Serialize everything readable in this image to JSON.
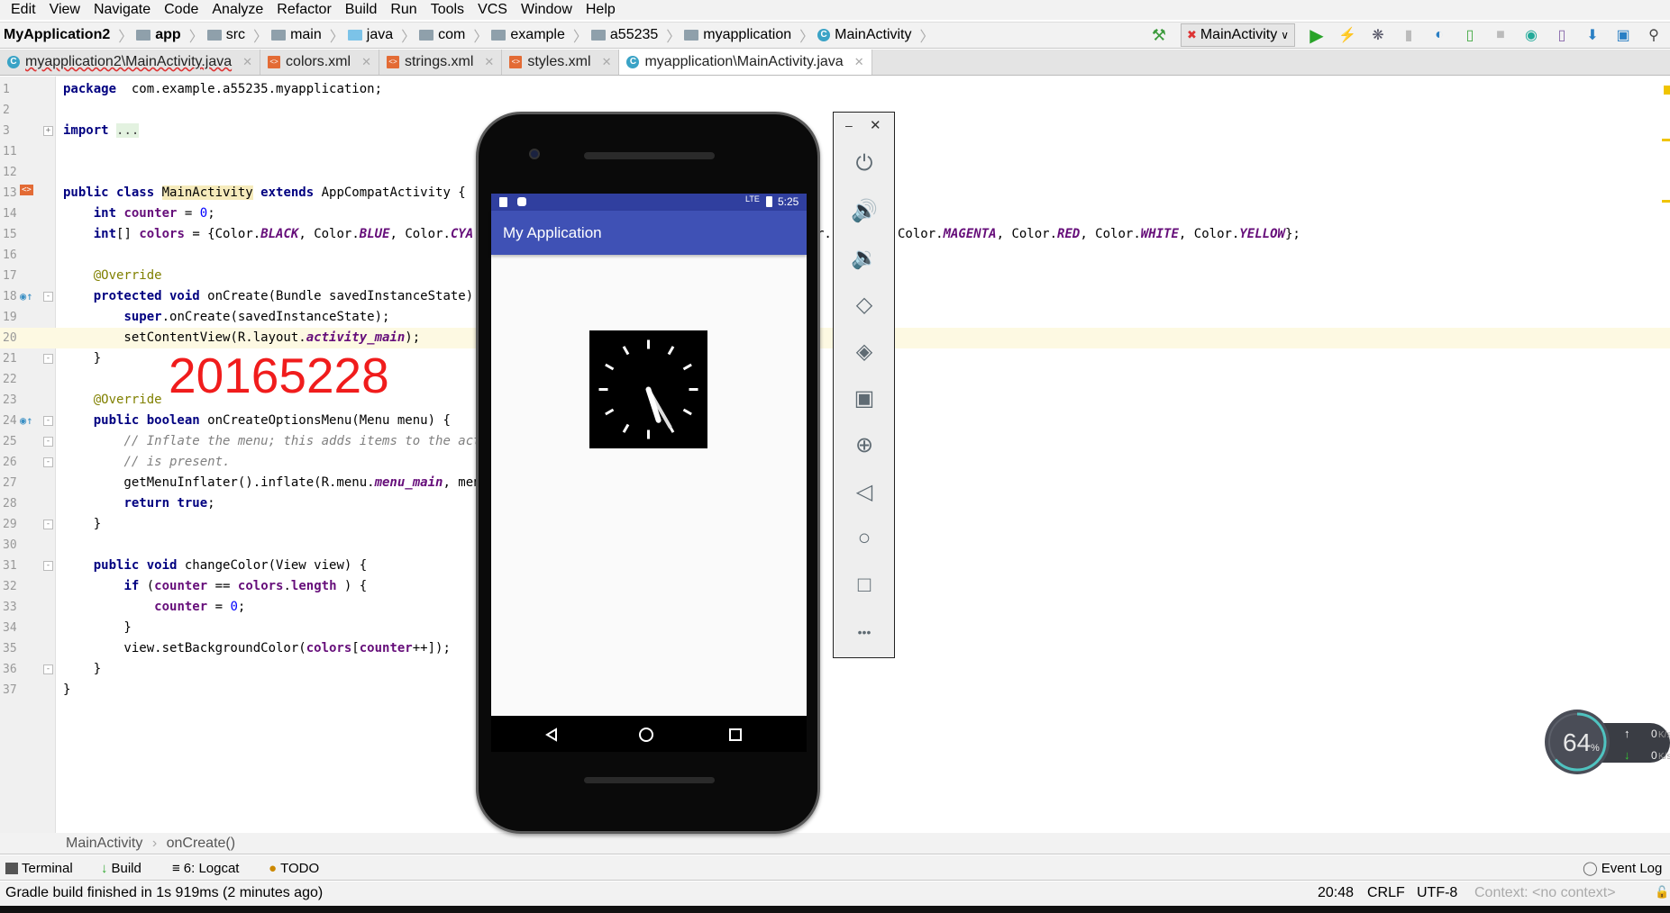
{
  "menu": [
    "Edit",
    "View",
    "Navigate",
    "Code",
    "Analyze",
    "Refactor",
    "Build",
    "Run",
    "Tools",
    "VCS",
    "Window",
    "Help"
  ],
  "breadcrumb": [
    {
      "label": "MyApplication2",
      "icon": "none"
    },
    {
      "label": "app",
      "icon": "module-folder-icon"
    },
    {
      "label": "src",
      "icon": "folder-icon"
    },
    {
      "label": "main",
      "icon": "folder-icon"
    },
    {
      "label": "java",
      "icon": "source-folder-icon"
    },
    {
      "label": "com",
      "icon": "package-icon"
    },
    {
      "label": "example",
      "icon": "package-icon"
    },
    {
      "label": "a55235",
      "icon": "package-icon"
    },
    {
      "label": "myapplication",
      "icon": "package-icon"
    },
    {
      "label": "MainActivity",
      "icon": "class-icon"
    }
  ],
  "toolbar": {
    "run_config": "MainActivity"
  },
  "tabs": [
    {
      "label": "myapplication2\\MainActivity.java",
      "icon": "class-icon",
      "active": false
    },
    {
      "label": "colors.xml",
      "icon": "xml-icon",
      "active": false
    },
    {
      "label": "strings.xml",
      "icon": "xml-icon",
      "active": false
    },
    {
      "label": "styles.xml",
      "icon": "xml-icon",
      "active": false
    },
    {
      "label": "myapplication\\MainActivity.java",
      "icon": "class-icon",
      "active": true
    }
  ],
  "code": [
    {
      "n": "1",
      "tokens": [
        [
          "kw",
          "package"
        ],
        [
          "",
          "  com.example.a55235.myapplication;"
        ]
      ]
    },
    {
      "n": "2",
      "tokens": []
    },
    {
      "n": "3",
      "tokens": [
        [
          "kw",
          "import"
        ],
        [
          "",
          " "
        ],
        [
          "fold",
          "..."
        ]
      ]
    },
    {
      "n": "11",
      "tokens": []
    },
    {
      "n": "12",
      "tokens": []
    },
    {
      "n": "13",
      "tokens": [
        [
          "kw",
          "public class "
        ],
        [
          "hl",
          "MainActivity"
        ],
        [
          "kw",
          " extends "
        ],
        [
          "",
          "AppCompatActivity {"
        ]
      ]
    },
    {
      "n": "14",
      "tokens": [
        [
          "",
          "    "
        ],
        [
          "kw",
          "int "
        ],
        [
          "fld",
          "counter"
        ],
        [
          "",
          " = "
        ],
        [
          "num",
          "0"
        ],
        [
          "",
          ";"
        ]
      ]
    },
    {
      "n": "15",
      "tokens": [
        [
          "",
          "    "
        ],
        [
          "kw",
          "int"
        ],
        [
          "",
          "[] "
        ],
        [
          "fld",
          "colors"
        ],
        [
          "",
          " = {Color."
        ],
        [
          "sfld",
          "BLACK"
        ],
        [
          "",
          ", Color."
        ],
        [
          "sfld",
          "BLUE"
        ],
        [
          "",
          ", Color."
        ],
        [
          "sfld",
          "CYA"
        ]
      ]
    },
    {
      "n": "16",
      "tokens": []
    },
    {
      "n": "17",
      "tokens": [
        [
          "",
          "    "
        ],
        [
          "ann",
          "@Override"
        ]
      ]
    },
    {
      "n": "18",
      "tokens": [
        [
          "",
          "    "
        ],
        [
          "kw",
          "protected void "
        ],
        [
          "",
          "onCreate(Bundle savedInstanceState)"
        ]
      ]
    },
    {
      "n": "19",
      "tokens": [
        [
          "",
          "        "
        ],
        [
          "kw",
          "super"
        ],
        [
          "",
          ".onCreate(savedInstanceState);"
        ]
      ]
    },
    {
      "n": "20",
      "tokens": [
        [
          "",
          "        setContentView(R.layout."
        ],
        [
          "sfld",
          "activity_main"
        ],
        [
          "",
          ");"
        ]
      ]
    },
    {
      "n": "21",
      "tokens": [
        [
          "",
          "    }"
        ]
      ]
    },
    {
      "n": "22",
      "tokens": []
    },
    {
      "n": "23",
      "tokens": [
        [
          "",
          "    "
        ],
        [
          "ann",
          "@Override"
        ]
      ]
    },
    {
      "n": "24",
      "tokens": [
        [
          "",
          "    "
        ],
        [
          "kw",
          "public boolean "
        ],
        [
          "",
          "onCreateOptionsMenu(Menu menu) {"
        ]
      ]
    },
    {
      "n": "25",
      "tokens": [
        [
          "",
          "        "
        ],
        [
          "cm",
          "// Inflate the menu; this adds items to the actio"
        ]
      ]
    },
    {
      "n": "26",
      "tokens": [
        [
          "",
          "        "
        ],
        [
          "cm",
          "// is present."
        ]
      ]
    },
    {
      "n": "27",
      "tokens": [
        [
          "",
          "        getMenuInflater().inflate(R.menu."
        ],
        [
          "sfld",
          "menu_main"
        ],
        [
          "",
          ", menu"
        ]
      ]
    },
    {
      "n": "28",
      "tokens": [
        [
          "",
          "        "
        ],
        [
          "kw",
          "return true"
        ],
        [
          "",
          ";"
        ]
      ]
    },
    {
      "n": "29",
      "tokens": [
        [
          "",
          "    }"
        ]
      ]
    },
    {
      "n": "30",
      "tokens": []
    },
    {
      "n": "31",
      "tokens": [
        [
          "",
          "    "
        ],
        [
          "kw",
          "public void "
        ],
        [
          "",
          "changeColor(View view) {"
        ]
      ]
    },
    {
      "n": "32",
      "tokens": [
        [
          "",
          "        "
        ],
        [
          "kw",
          "if "
        ],
        [
          "",
          "("
        ],
        [
          "fld",
          "counter"
        ],
        [
          "",
          " == "
        ],
        [
          "fld",
          "colors"
        ],
        [
          "",
          "."
        ],
        [
          "fld",
          "length"
        ],
        [
          "",
          " ) {"
        ]
      ]
    },
    {
      "n": "33",
      "tokens": [
        [
          "",
          "            "
        ],
        [
          "fld",
          "counter"
        ],
        [
          "",
          " = "
        ],
        [
          "num",
          "0"
        ],
        [
          "",
          ";"
        ]
      ]
    },
    {
      "n": "34",
      "tokens": [
        [
          "",
          "        }"
        ]
      ]
    },
    {
      "n": "35",
      "tokens": [
        [
          "",
          "        view.setBackgroundColor("
        ],
        [
          "fld",
          "colors"
        ],
        [
          "",
          "["
        ],
        [
          "fld",
          "counter"
        ],
        [
          "",
          "++]);"
        ]
      ]
    },
    {
      "n": "36",
      "tokens": [
        [
          "",
          "    }"
        ]
      ]
    },
    {
      "n": "37",
      "tokens": [
        [
          "",
          "}"
        ]
      ]
    }
  ],
  "line15_right": {
    "fragment": "r.",
    "tokens": [
      [
        "",
        "Color."
      ],
      [
        "sfld",
        "MAGENTA"
      ],
      [
        "",
        ", Color."
      ],
      [
        "sfld",
        "RED"
      ],
      [
        "",
        ", Color."
      ],
      [
        "sfld",
        "WHITE"
      ],
      [
        "",
        ", Color."
      ],
      [
        "sfld",
        "YELLOW"
      ],
      [
        "",
        "};"
      ]
    ]
  },
  "overlay_text": "20165228",
  "emulator": {
    "status_time": "5:25",
    "network": "LTE",
    "app_title": "My Application",
    "panel_buttons": [
      "power-icon",
      "volume-up-icon",
      "volume-down-icon",
      "rotate-left-icon",
      "rotate-right-icon",
      "camera-icon",
      "zoom-icon",
      "back-icon",
      "home-icon",
      "overview-icon",
      "more-icon"
    ]
  },
  "bottom_breadcrumb": [
    "MainActivity",
    "onCreate()"
  ],
  "tool_windows": [
    {
      "label": "Terminal",
      "icon": "terminal-icon"
    },
    {
      "label": "Build",
      "icon": "build-icon"
    },
    {
      "label": "6: Logcat",
      "icon": "logcat-icon"
    },
    {
      "label": "TODO",
      "icon": "todo-icon"
    }
  ],
  "event_log": "Event Log",
  "status": {
    "message": "Gradle build finished in 1s 919ms (2 minutes ago)",
    "position": "20:48",
    "line_sep": "CRLF",
    "encoding": "UTF-8",
    "context": "Context: <no context>"
  },
  "net_widget": {
    "percent": "64",
    "percent_sign": "%",
    "up": "0",
    "up_unit": "K/s",
    "down": "0",
    "down_unit": "K/s",
    "fill_fraction": 0.64
  },
  "colors": {
    "accent": "#3f51b5",
    "status_bar": "#303f9f",
    "overlay_red": "#f01c1c"
  }
}
